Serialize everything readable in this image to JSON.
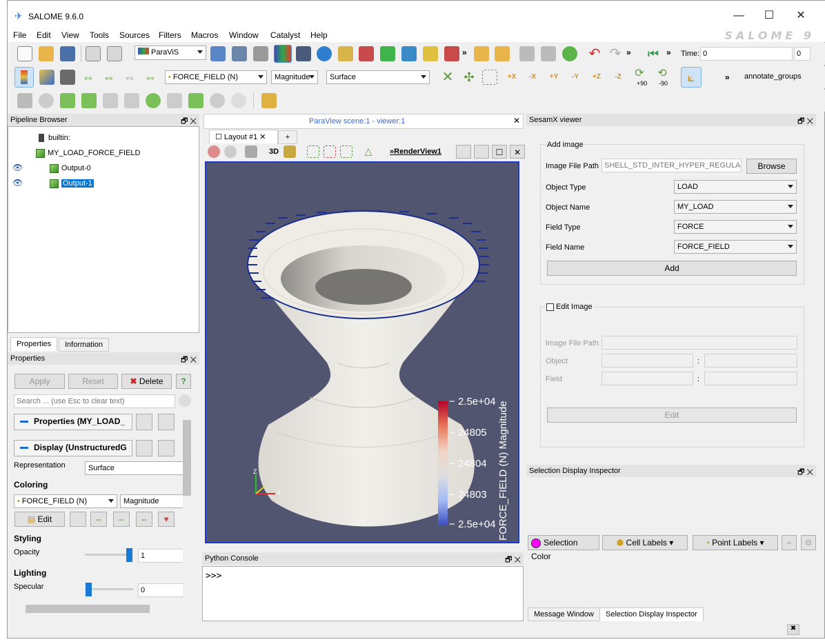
{
  "window": {
    "title": "SALOME  9.6.0",
    "brand": "SALOME 9",
    "minimize": "—",
    "maximize": "☐",
    "close": "✕"
  },
  "menus": [
    "File",
    "Edit",
    "View",
    "Tools",
    "Sources",
    "Filters",
    "Macros",
    "Window",
    "Catalyst",
    "Help"
  ],
  "toolbar1": {
    "module": "ParaViS",
    "time_label": "Time:",
    "time_value": "0",
    "time_index": "0",
    "more": "»"
  },
  "toolbar2": {
    "color_field": "FORCE_FIELD (N)",
    "component": "Magnitude",
    "representation": "Surface",
    "annotate": "annotate_groups",
    "more": "»",
    "rot_pos": "+90",
    "rot_neg": "-90"
  },
  "pipeline": {
    "title": "Pipeline Browser",
    "items": [
      {
        "label": "builtin:"
      },
      {
        "label": "MY_LOAD_FORCE_FIELD"
      },
      {
        "label": "Output-0"
      },
      {
        "label": "Output-1"
      }
    ]
  },
  "props": {
    "tabs": [
      "Properties",
      "Information"
    ],
    "title": "Properties",
    "apply": "Apply",
    "reset": "Reset",
    "delete": "Delete",
    "help": "?",
    "search_placeholder": "Search ... (use Esc to clear text)",
    "section_props": "Properties (MY_LOAD_",
    "section_display": "Display (UnstructuredG",
    "representation_label": "Representation",
    "representation_value": "Surface",
    "coloring": "Coloring",
    "color_field": "FORCE_FIELD (N)",
    "color_comp": "Magnitude",
    "edit": "Edit",
    "styling": "Styling",
    "opacity_label": "Opacity",
    "opacity_value": "1",
    "lighting": "Lighting",
    "specular_label": "Specular",
    "specular_value": "0"
  },
  "viewer": {
    "scene_title": "ParaView scene:1 - viewer:1",
    "layout_tab": "Layout #1",
    "add_tab": "+",
    "view_label": "RenderView1",
    "btn3d": "3D",
    "more": "»"
  },
  "colorbar": {
    "title": "FORCE_FIELD (N) Magnitude",
    "ticks": [
      "2.5e+04",
      "24805",
      "24804",
      "24803",
      "2.5e+04"
    ]
  },
  "axes": {
    "z": "Z",
    "x": "X"
  },
  "console": {
    "title": "Python Console",
    "prompt": ">>>"
  },
  "sesamx": {
    "title": "SesamX viewer",
    "add_group": "Add image",
    "image_file_path_label": "Image File Path",
    "image_file_path": "SHELL_STD_INTER_HYPER_REGULAR.h5",
    "browse": "Browse",
    "object_type_label": "Object Type",
    "object_type": "LOAD",
    "object_name_label": "Object Name",
    "object_name": "MY_LOAD",
    "field_type_label": "Field Type",
    "field_type": "FORCE",
    "field_name_label": "Field Name",
    "field_name": "FORCE_FIELD",
    "add": "Add",
    "edit_group": "Edit Image",
    "edit_path_label": "Image File Path",
    "object_label": "Object",
    "field_label": "Field",
    "colon": ":",
    "edit": "Edit"
  },
  "inspector": {
    "title": "Selection Display Inspector",
    "selection_color": "Selection Color",
    "cell_labels": "Cell Labels",
    "point_labels": "Point Labels"
  },
  "bottom_tabs": [
    "Message Window",
    "Selection Display Inspector"
  ],
  "colors": {
    "accent": "#0078d7",
    "viewport_bg": "#525570",
    "arrow": "#1a2f8f"
  }
}
